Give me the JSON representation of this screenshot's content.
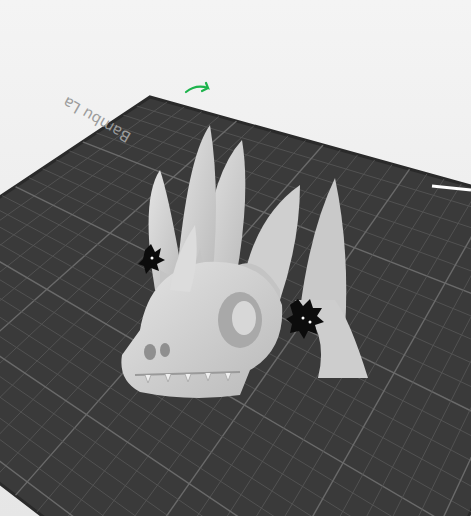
{
  "viewport": {
    "plate_label": "Bambu La"
  }
}
